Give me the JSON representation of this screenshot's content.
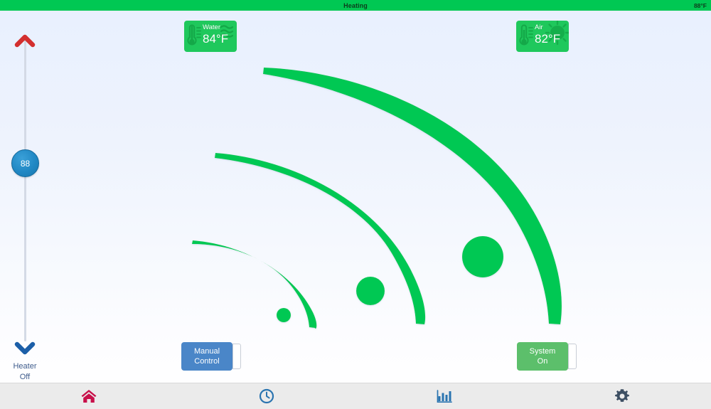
{
  "header": {
    "title": "Heating",
    "temperature": "88°F",
    "bg_color": "#00c853"
  },
  "badges": [
    {
      "id": "water",
      "label": "Water",
      "value": "84°F",
      "icon": "thermometer-waves-icon",
      "color": "#1fc85c"
    },
    {
      "id": "air",
      "label": "Air",
      "value": "82°F",
      "icon": "thermometer-sun-icon",
      "color": "#1fc85c"
    }
  ],
  "slider": {
    "up_icon": "chevron-up-icon",
    "down_icon": "chevron-down-icon",
    "thumb_value": "88",
    "status_line1": "Heater",
    "status_line2": "Off",
    "up_color": "#d32f2f",
    "down_color": "#1c5fa8",
    "thumb_color": "#2188c4"
  },
  "buttons": [
    {
      "id": "manual-control",
      "line1": "Manual",
      "line2": "Control",
      "color": "#4a86c8"
    },
    {
      "id": "system-on",
      "line1": "System",
      "line2": "On",
      "color": "#5cbf6b"
    }
  ],
  "nav": [
    {
      "id": "home",
      "icon": "home-icon",
      "color": "#c8104a"
    },
    {
      "id": "schedule",
      "icon": "clock-icon",
      "color": "#2a74b0"
    },
    {
      "id": "stats",
      "icon": "bar-chart-icon",
      "color": "#2a74b0"
    },
    {
      "id": "settings",
      "icon": "gear-icon",
      "color": "#3d4f63"
    }
  ],
  "jets": {
    "color": "#00c853",
    "count": 3,
    "items": [
      {
        "id": "jet-small",
        "nozzle_r": 10,
        "label": "small-jet-arc"
      },
      {
        "id": "jet-medium",
        "nozzle_r": 20,
        "label": "medium-jet-arc"
      },
      {
        "id": "jet-large",
        "nozzle_r": 29,
        "label": "large-jet-arc"
      }
    ]
  }
}
